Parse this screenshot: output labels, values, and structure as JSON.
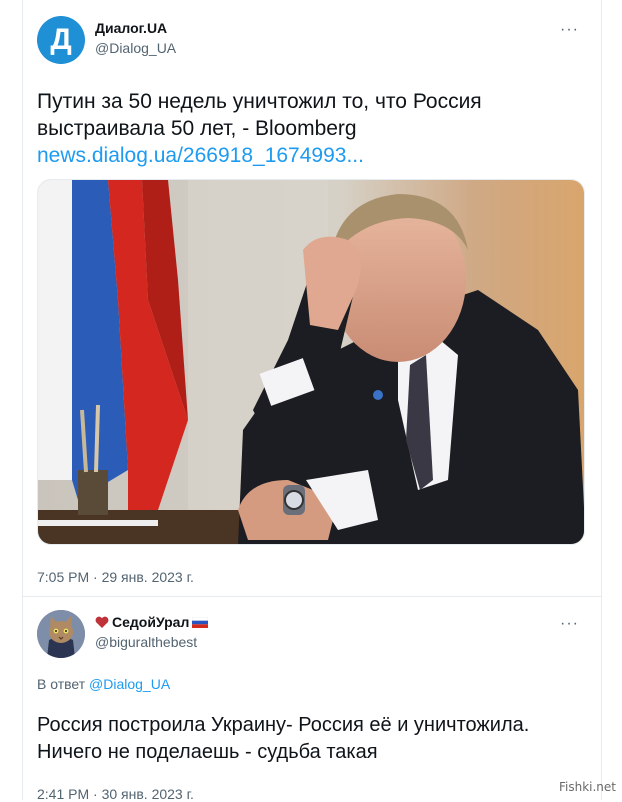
{
  "tweet1": {
    "avatar_letter": "Д",
    "display_name": "Диалог.UA",
    "handle": "@Dialog_UA",
    "more": "···",
    "text": "Путин за 50 недель уничтожил то, что Россия выстраивала 50 лет, - Bloomberg",
    "link": "news.dialog.ua/266918_1674993...",
    "timestamp": "7:05 PM · 29 янв. 2023 г."
  },
  "tweet2": {
    "display_name": "СедойУрал",
    "handle": "@biguralthebest",
    "more": "···",
    "reply_prefix": "В ответ",
    "reply_handle": "@Dialog_UA",
    "text": "Россия построила Украину- Россия её и уничтожила. Ничего не поделаешь - судьба такая",
    "timestamp": "2:41 PM · 30 янв. 2023 г."
  },
  "watermark": "Fishki.net",
  "colors": {
    "link": "#1d9bf0",
    "secondary_text": "#536471",
    "brand_dialog": "#1f8fd6"
  }
}
